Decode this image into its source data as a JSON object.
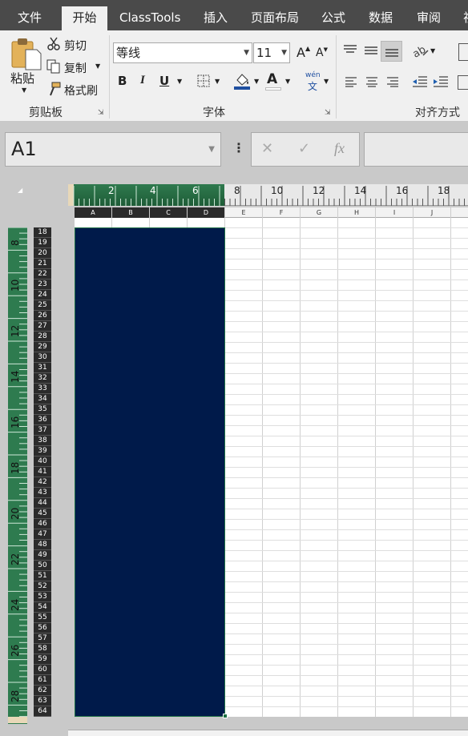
{
  "tabs": [
    "文件",
    "开始",
    "ClassTools",
    "插入",
    "页面布局",
    "公式",
    "数据",
    "审阅",
    "视"
  ],
  "clipboard": {
    "paste": "粘贴",
    "cut": "剪切",
    "copy": "复制",
    "format_painter": "格式刷",
    "group": "剪贴板"
  },
  "font": {
    "name": "等线",
    "size": "11",
    "bold": "B",
    "italic": "I",
    "underline": "U",
    "grow": "A",
    "shrink": "A",
    "font_color": "A",
    "group": "字体",
    "wen": "wén",
    "wen_char": "文"
  },
  "alignment": {
    "group": "对齐方式"
  },
  "formula_bar": {
    "name_box": "A1",
    "cancel": "✕",
    "enter": "✓",
    "fx": "fx"
  },
  "hruler": {
    "labels": [
      "2",
      "4",
      "6",
      "8",
      "10",
      "12",
      "14",
      "16",
      "18"
    ]
  },
  "columns": [
    "A",
    "B",
    "C",
    "D",
    "E",
    "F",
    "G",
    "H",
    "I",
    "J"
  ],
  "vruler": {
    "labels": [
      "8",
      "10",
      "12",
      "14",
      "16",
      "18",
      "20",
      "22",
      "24",
      "26",
      "28"
    ]
  },
  "rows": [
    "18",
    "19",
    "20",
    "21",
    "22",
    "23",
    "24",
    "25",
    "26",
    "27",
    "28",
    "29",
    "30",
    "31",
    "32",
    "33",
    "34",
    "35",
    "36",
    "37",
    "38",
    "39",
    "40",
    "41",
    "42",
    "43",
    "44",
    "45",
    "46",
    "47",
    "48",
    "49",
    "50",
    "51",
    "52",
    "53",
    "54",
    "55",
    "56",
    "57",
    "58",
    "59",
    "60",
    "61",
    "62",
    "63",
    "64"
  ],
  "colors": {
    "fill": "#001a4a",
    "selection": "#1e7145",
    "ruler": "#2e7b4f"
  }
}
